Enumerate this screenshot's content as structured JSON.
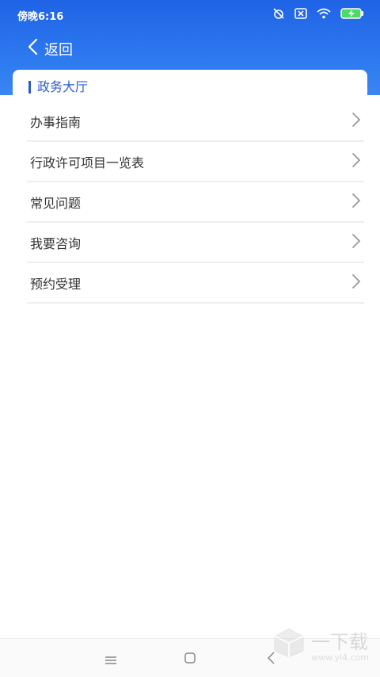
{
  "statusbar": {
    "time": "傍晚6:16"
  },
  "nav": {
    "back_label": "返回"
  },
  "section": {
    "title": "政务大厅"
  },
  "items": [
    {
      "label": "办事指南"
    },
    {
      "label": "行政许可项目一览表"
    },
    {
      "label": "常见问题"
    },
    {
      "label": "我要咨询"
    },
    {
      "label": "预约受理"
    }
  ],
  "watermark": {
    "brand": "一下载",
    "url": "www.yi4.com"
  },
  "colors": {
    "header": "#2f7cf0",
    "accent": "#2a5bd1"
  }
}
